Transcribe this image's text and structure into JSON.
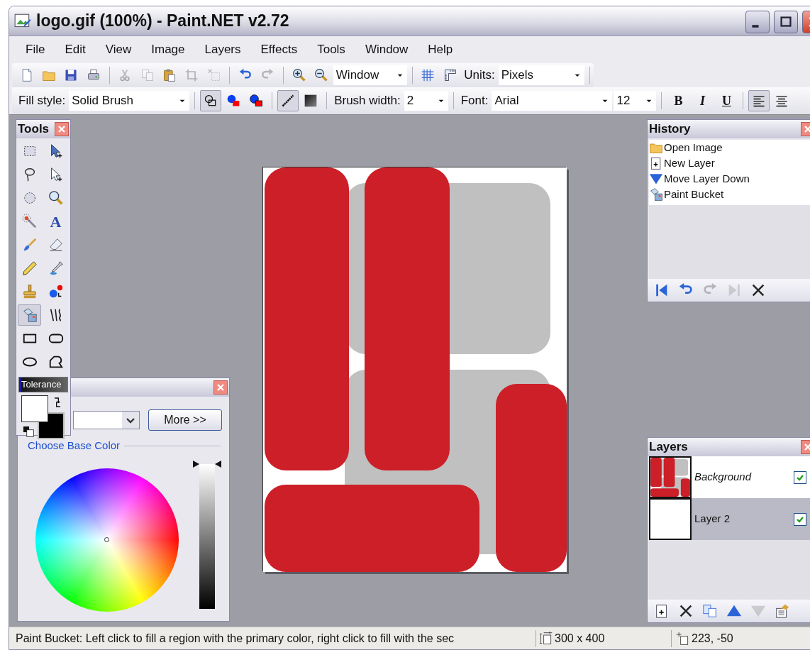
{
  "window": {
    "title": "logo.gif (100%) - Paint.NET v2.72"
  },
  "menu": [
    {
      "label": "File"
    },
    {
      "label": "Edit"
    },
    {
      "label": "View"
    },
    {
      "label": "Image"
    },
    {
      "label": "Layers"
    },
    {
      "label": "Effects"
    },
    {
      "label": "Tools"
    },
    {
      "label": "Window"
    },
    {
      "label": "Help"
    }
  ],
  "toolbar_1": [
    {
      "kind": "button",
      "disabled": false
    },
    {
      "kind": "button",
      "disabled": false
    },
    {
      "kind": "button",
      "disabled": false
    },
    {
      "kind": "button",
      "disabled": false
    },
    {
      "kind": "separator"
    },
    {
      "kind": "button",
      "disabled": true
    },
    {
      "kind": "button",
      "disabled": true
    },
    {
      "kind": "button",
      "disabled": false
    },
    {
      "kind": "button",
      "disabled": true
    },
    {
      "kind": "button",
      "disabled": true
    },
    {
      "kind": "separator"
    },
    {
      "kind": "button",
      "disabled": false
    },
    {
      "kind": "button",
      "disabled": true
    },
    {
      "kind": "separator"
    },
    {
      "kind": "button",
      "disabled": false
    },
    {
      "kind": "button",
      "disabled": false
    },
    {
      "kind": "dropdown",
      "value": "Window"
    },
    {
      "kind": "separator"
    },
    {
      "kind": "button",
      "disabled": false
    },
    {
      "kind": "button",
      "disabled": false
    },
    {
      "kind": "label",
      "text": "Units:"
    },
    {
      "kind": "dropdown",
      "value": "Pixels"
    },
    {
      "kind": "separator"
    }
  ],
  "toolbar_2": [
    {
      "kind": "label",
      "text": "Fill style:"
    },
    {
      "kind": "dropdown",
      "value": "Solid Brush"
    },
    {
      "kind": "separator"
    },
    {
      "kind": "button",
      "selected": true
    },
    {
      "kind": "button",
      "selected": false
    },
    {
      "kind": "button",
      "selected": false
    },
    {
      "kind": "separator"
    },
    {
      "kind": "button",
      "selected": true
    },
    {
      "kind": "button",
      "selected": false
    },
    {
      "kind": "separator"
    },
    {
      "kind": "label",
      "text": "Brush width:"
    },
    {
      "kind": "dropdown",
      "value": "2"
    },
    {
      "kind": "separator"
    },
    {
      "kind": "label",
      "text": "Font:"
    },
    {
      "kind": "dropdown",
      "value": "Arial"
    },
    {
      "kind": "dropdown",
      "value": "12"
    },
    {
      "kind": "separator"
    },
    {
      "kind": "glyph",
      "label": "B",
      "selected": false
    },
    {
      "kind": "glyph",
      "label": "I",
      "selected": false
    },
    {
      "kind": "glyph",
      "label": "U",
      "selected": false
    },
    {
      "kind": "separator"
    },
    {
      "kind": "button",
      "selected": true
    },
    {
      "kind": "button",
      "selected": false
    }
  ],
  "tools_palette": {
    "title": "Tools",
    "tools": [
      {
        "selected": false
      },
      {
        "selected": false
      },
      {
        "selected": false
      },
      {
        "selected": false
      },
      {
        "selected": false
      },
      {
        "selected": false
      },
      {
        "selected": false
      },
      {
        "glyph": "A",
        "selected": false
      },
      {
        "selected": false
      },
      {
        "selected": false
      },
      {
        "selected": false
      },
      {
        "selected": false
      },
      {
        "selected": false
      },
      {
        "selected": false
      },
      {
        "selected": true
      },
      {
        "selected": false
      },
      {
        "selected": false
      },
      {
        "selected": false
      },
      {
        "selected": false
      },
      {
        "selected": false
      }
    ],
    "tolerance": {
      "label": "Tolerance",
      "level": 0.04
    },
    "swatches": [
      {
        "kind": "primary",
        "color": "#ffffff"
      },
      {
        "kind": "secondary",
        "color": "#000000"
      }
    ]
  },
  "colors_palette": {
    "more_button": "More >>",
    "link": "Choose Base Color",
    "brightness": {
      "level": 1
    }
  },
  "history": {
    "title": "History",
    "items": [
      {
        "label": "Open Image"
      },
      {
        "label": "New Layer"
      },
      {
        "label": "Move Layer Down"
      },
      {
        "label": "Paint Bucket"
      }
    ],
    "buttons": [
      {
        "disabled": false
      },
      {
        "disabled": false
      },
      {
        "disabled": true
      },
      {
        "disabled": true
      },
      {
        "disabled": false
      }
    ]
  },
  "layers": {
    "title": "Layers",
    "items": [
      {
        "name": "Background",
        "italic": true,
        "selected": false,
        "visible": true,
        "kind": "drawing"
      },
      {
        "name": "Layer 2",
        "italic": false,
        "selected": true,
        "visible": true,
        "kind": "blank"
      }
    ],
    "buttons": [
      {
        "disabled": false
      },
      {
        "disabled": false
      },
      {
        "disabled": false
      },
      {
        "disabled": false
      },
      {
        "disabled": true
      },
      {
        "disabled": false
      }
    ]
  },
  "status_bar": {
    "hint": "Paint Bucket: Left click to fill a region with the primary color, right click to fill with the sec",
    "image_size": "300 x 400",
    "cursor_position": "223, -50"
  }
}
